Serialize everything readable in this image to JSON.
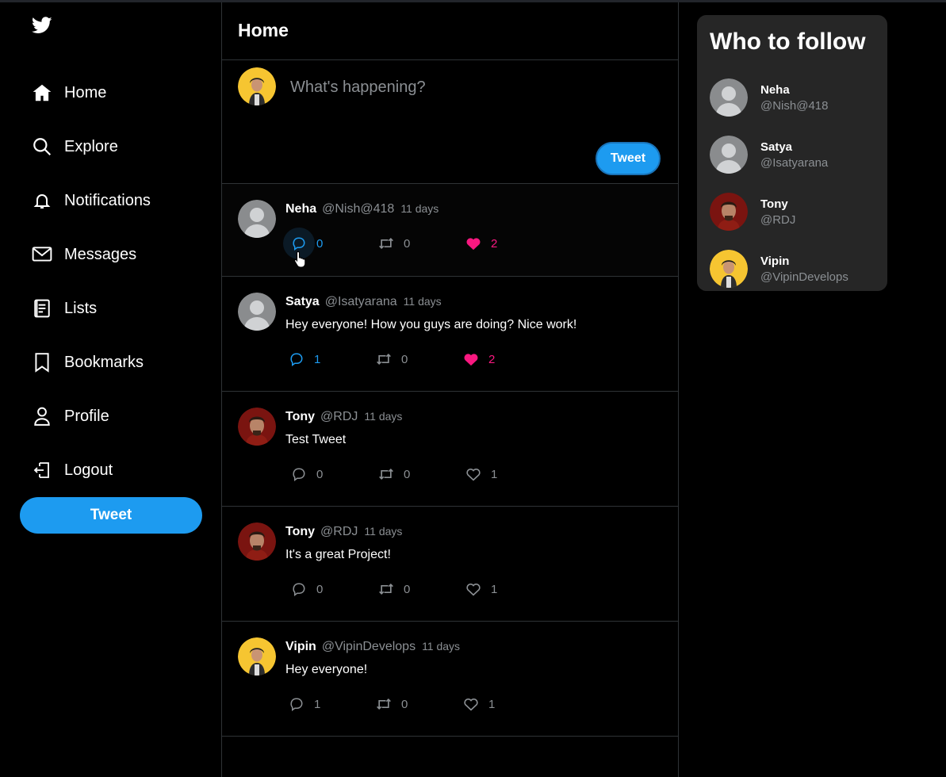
{
  "sidebar": {
    "items": [
      {
        "label": "Home",
        "icon": "home-icon"
      },
      {
        "label": "Explore",
        "icon": "search-icon"
      },
      {
        "label": "Notifications",
        "icon": "bell-icon"
      },
      {
        "label": "Messages",
        "icon": "mail-icon"
      },
      {
        "label": "Lists",
        "icon": "list-icon"
      },
      {
        "label": "Bookmarks",
        "icon": "bookmark-icon"
      },
      {
        "label": "Profile",
        "icon": "user-icon"
      },
      {
        "label": "Logout",
        "icon": "logout-icon"
      }
    ],
    "tweet_label": "Tweet"
  },
  "main": {
    "title": "Home",
    "compose": {
      "placeholder": "What's happening?",
      "button_label": "Tweet"
    },
    "tweets": [
      {
        "name": "Neha",
        "handle": "@Nish@418",
        "time": "11 days",
        "text": "",
        "replies": "0",
        "retweets": "0",
        "likes": "2",
        "liked": true
      },
      {
        "name": "Satya",
        "handle": "@Isatyarana",
        "time": "11 days",
        "text": "Hey everyone! How you guys are doing? Nice work!",
        "replies": "1",
        "retweets": "0",
        "likes": "2",
        "liked": true
      },
      {
        "name": "Tony",
        "handle": "@RDJ",
        "time": "11 days",
        "text": "Test Tweet",
        "replies": "0",
        "retweets": "0",
        "likes": "1",
        "liked": false
      },
      {
        "name": "Tony",
        "handle": "@RDJ",
        "time": "11 days",
        "text": "It's a great Project!",
        "replies": "0",
        "retweets": "0",
        "likes": "1",
        "liked": false
      },
      {
        "name": "Vipin",
        "handle": "@VipinDevelops",
        "time": "11 days",
        "text": "Hey everyone!",
        "replies": "1",
        "retweets": "0",
        "likes": "1",
        "liked": false
      }
    ]
  },
  "who_to_follow": {
    "title": "Who to follow",
    "users": [
      {
        "name": "Neha",
        "handle": "@Nish@418"
      },
      {
        "name": "Satya",
        "handle": "@Isatyarana"
      },
      {
        "name": "Tony",
        "handle": "@RDJ"
      },
      {
        "name": "Vipin",
        "handle": "@VipinDevelops"
      }
    ]
  },
  "colors": {
    "accent": "#1d9bf0",
    "like": "#f91880",
    "reply_active": "#1d9bf0",
    "muted": "#8b8f93",
    "panel": "#262626"
  }
}
